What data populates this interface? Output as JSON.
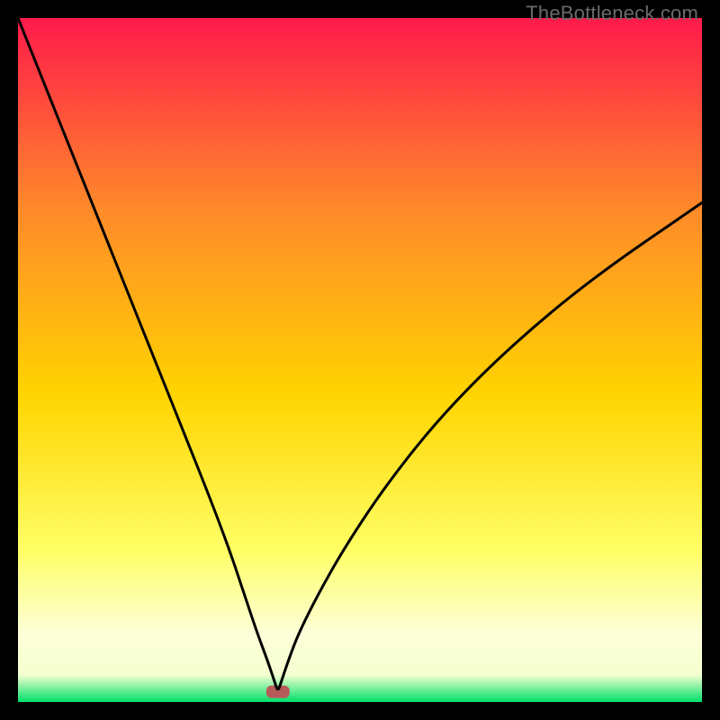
{
  "watermark": "TheBottleneck.com",
  "chart_data": {
    "type": "line",
    "title": "",
    "xlabel": "",
    "ylabel": "",
    "xlim": [
      0,
      100
    ],
    "ylim": [
      0,
      100
    ],
    "grid": false,
    "legend": false,
    "background_gradient": {
      "top_color": "#ff1a4b",
      "mid_top_color": "#ff8a2a",
      "mid_color": "#ffd400",
      "mid_low_color": "#ffff66",
      "low_color": "#f5ffd0",
      "bottom_color": "#00e06a"
    },
    "optimum_marker": {
      "x": 38,
      "y": 1.5,
      "color": "#b95a5a",
      "shape": "rounded-rect"
    },
    "series": [
      {
        "name": "bottleneck-curve",
        "x": [
          0,
          4,
          8,
          12,
          16,
          20,
          24,
          28,
          31,
          33,
          35,
          36.5,
          37.5,
          38,
          38.5,
          39.5,
          41,
          44,
          48,
          54,
          62,
          72,
          84,
          100
        ],
        "y": [
          100,
          90,
          80,
          70,
          60,
          50,
          40,
          30,
          22,
          16,
          10,
          6,
          3,
          1.5,
          3,
          6,
          10,
          16,
          23,
          32,
          42,
          52,
          62,
          73
        ]
      }
    ]
  }
}
